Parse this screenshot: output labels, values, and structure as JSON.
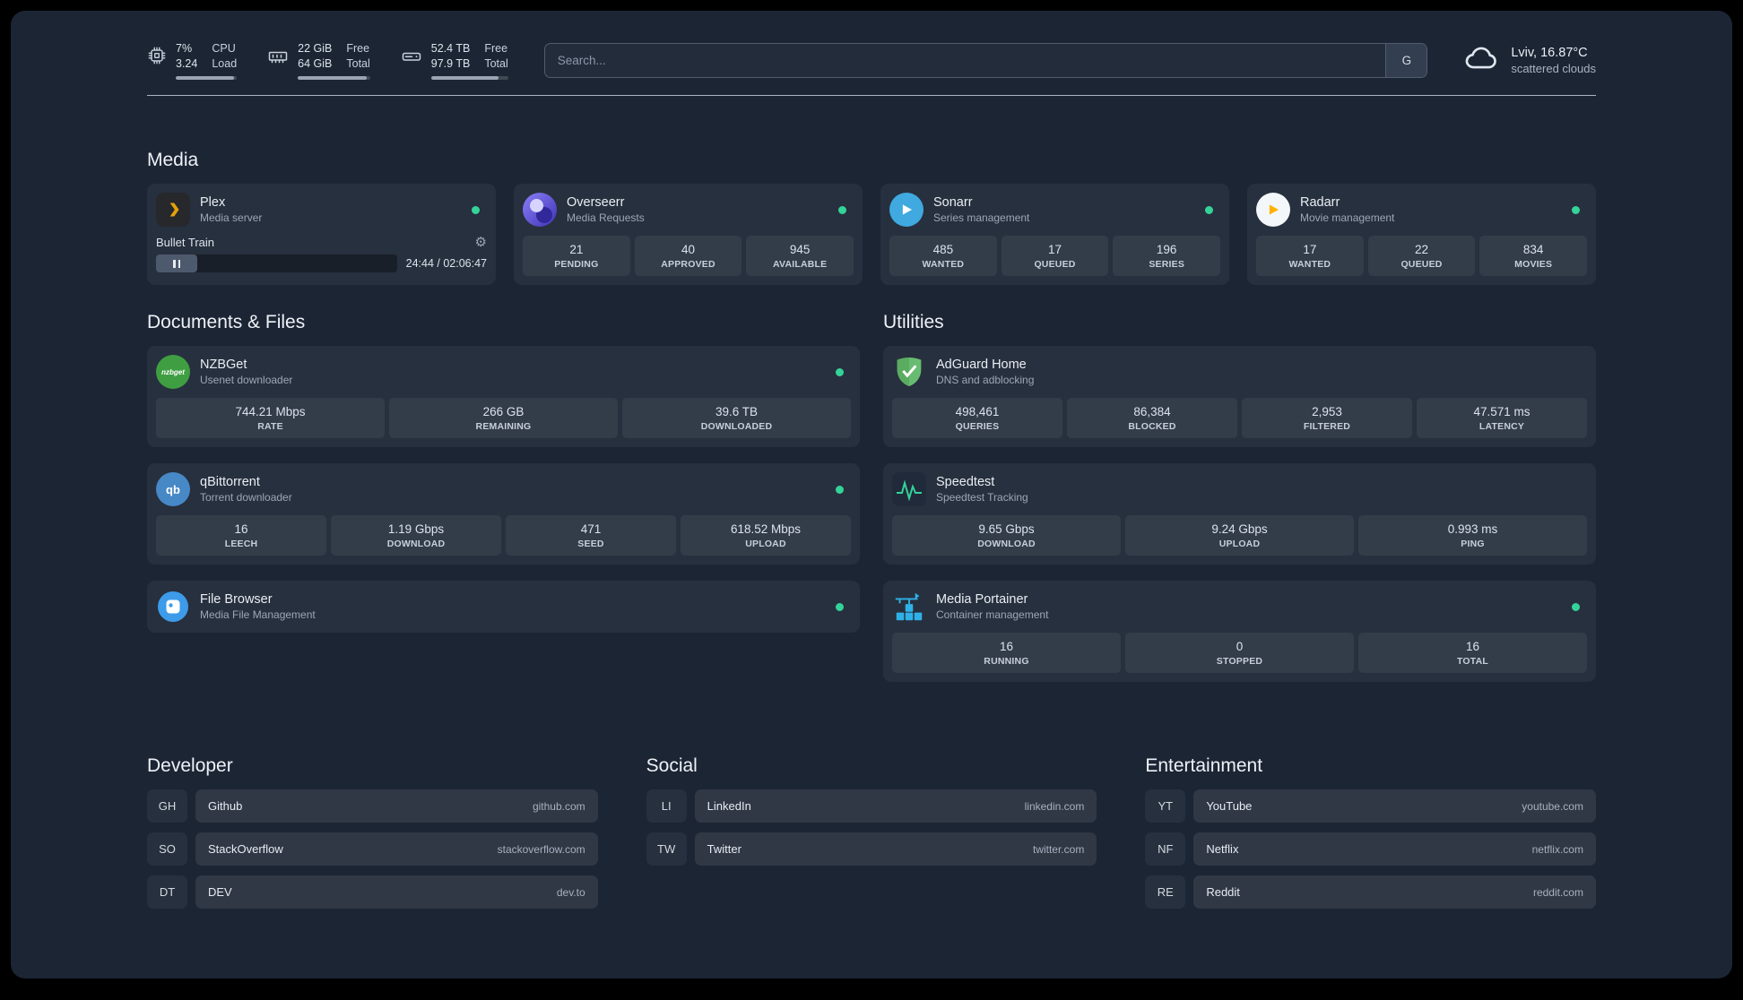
{
  "theme": {
    "background": "#1c2534",
    "card": "#252e3e",
    "tile": "#2d3747",
    "status_online": "#34d399",
    "accent_purple": "#6c63e0",
    "accent_green": "#3f9e42",
    "accent_blue": "#3fa9e0",
    "accent_amber": "#e5a00d"
  },
  "topbar": {
    "cpu": {
      "icon": "cpu-chip-icon",
      "value": "7%",
      "sub": "3.24",
      "label1": "CPU",
      "label2": "Load",
      "bar_percent": 95
    },
    "memory": {
      "icon": "memory-icon",
      "value": "22 GiB",
      "sub": "64 GiB",
      "label1": "Free",
      "label2": "Total",
      "bar_percent": 95
    },
    "disk": {
      "icon": "disk-icon",
      "value": "52.4 TB",
      "sub": "97.9 TB",
      "label1": "Free",
      "label2": "Total",
      "bar_percent": 88
    },
    "search": {
      "placeholder": "Search...",
      "provider_button": "G"
    },
    "weather": {
      "icon": "cloud-icon",
      "location": "Lviv, 16.87°C",
      "condition": "scattered clouds"
    }
  },
  "media": {
    "title": "Media",
    "services": [
      {
        "name": "Plex",
        "desc": "Media server",
        "icon": "plex-icon",
        "online": true,
        "player": {
          "track": "Bullet Train",
          "time": "24:44 / 02:06:47"
        }
      },
      {
        "name": "Overseerr",
        "desc": "Media Requests",
        "icon": "overseerr-icon",
        "online": true,
        "stats": [
          {
            "value": "21",
            "label": "PENDING"
          },
          {
            "value": "40",
            "label": "APPROVED"
          },
          {
            "value": "945",
            "label": "AVAILABLE"
          }
        ]
      },
      {
        "name": "Sonarr",
        "desc": "Series management",
        "icon": "sonarr-icon",
        "online": true,
        "stats": [
          {
            "value": "485",
            "label": "WANTED"
          },
          {
            "value": "17",
            "label": "QUEUED"
          },
          {
            "value": "196",
            "label": "SERIES"
          }
        ]
      },
      {
        "name": "Radarr",
        "desc": "Movie management",
        "icon": "radarr-icon",
        "online": true,
        "stats": [
          {
            "value": "17",
            "label": "WANTED"
          },
          {
            "value": "22",
            "label": "QUEUED"
          },
          {
            "value": "834",
            "label": "MOVIES"
          }
        ]
      }
    ]
  },
  "documents": {
    "title": "Documents & Files",
    "services": [
      {
        "name": "NZBGet",
        "desc": "Usenet downloader",
        "icon": "nzbget-icon",
        "online": true,
        "stats": [
          {
            "value": "744.21 Mbps",
            "label": "RATE"
          },
          {
            "value": "266 GB",
            "label": "REMAINING"
          },
          {
            "value": "39.6 TB",
            "label": "DOWNLOADED"
          }
        ]
      },
      {
        "name": "qBittorrent",
        "desc": "Torrent downloader",
        "icon": "qbittorrent-icon",
        "online": true,
        "stats": [
          {
            "value": "16",
            "label": "LEECH"
          },
          {
            "value": "1.19 Gbps",
            "label": "DOWNLOAD"
          },
          {
            "value": "471",
            "label": "SEED"
          },
          {
            "value": "618.52 Mbps",
            "label": "UPLOAD"
          }
        ]
      },
      {
        "name": "File Browser",
        "desc": "Media File Management",
        "icon": "filebrowser-icon",
        "online": true
      }
    ]
  },
  "utilities": {
    "title": "Utilities",
    "services": [
      {
        "name": "AdGuard Home",
        "desc": "DNS and adblocking",
        "icon": "adguard-icon",
        "online": false,
        "stats": [
          {
            "value": "498,461",
            "label": "QUERIES"
          },
          {
            "value": "86,384",
            "label": "BLOCKED"
          },
          {
            "value": "2,953",
            "label": "FILTERED"
          },
          {
            "value": "47.571 ms",
            "label": "LATENCY"
          }
        ]
      },
      {
        "name": "Speedtest",
        "desc": "Speedtest Tracking",
        "icon": "speedtest-icon",
        "online": false,
        "stats": [
          {
            "value": "9.65 Gbps",
            "label": "DOWNLOAD"
          },
          {
            "value": "9.24 Gbps",
            "label": "UPLOAD"
          },
          {
            "value": "0.993 ms",
            "label": "PING"
          }
        ]
      },
      {
        "name": "Media Portainer",
        "desc": "Container management",
        "icon": "portainer-icon",
        "online": true,
        "stats": [
          {
            "value": "16",
            "label": "RUNNING"
          },
          {
            "value": "0",
            "label": "STOPPED"
          },
          {
            "value": "16",
            "label": "TOTAL"
          }
        ]
      }
    ]
  },
  "bookmarks": {
    "groups": [
      {
        "title": "Developer",
        "items": [
          {
            "abbr": "GH",
            "name": "Github",
            "url": "github.com"
          },
          {
            "abbr": "SO",
            "name": "StackOverflow",
            "url": "stackoverflow.com"
          },
          {
            "abbr": "DT",
            "name": "DEV",
            "url": "dev.to"
          }
        ]
      },
      {
        "title": "Social",
        "items": [
          {
            "abbr": "LI",
            "name": "LinkedIn",
            "url": "linkedin.com"
          },
          {
            "abbr": "TW",
            "name": "Twitter",
            "url": "twitter.com"
          }
        ]
      },
      {
        "title": "Entertainment",
        "items": [
          {
            "abbr": "YT",
            "name": "YouTube",
            "url": "youtube.com"
          },
          {
            "abbr": "NF",
            "name": "Netflix",
            "url": "netflix.com"
          },
          {
            "abbr": "RE",
            "name": "Reddit",
            "url": "reddit.com"
          }
        ]
      }
    ]
  },
  "player_controls": {
    "pause": "pause",
    "gear": "settings"
  }
}
